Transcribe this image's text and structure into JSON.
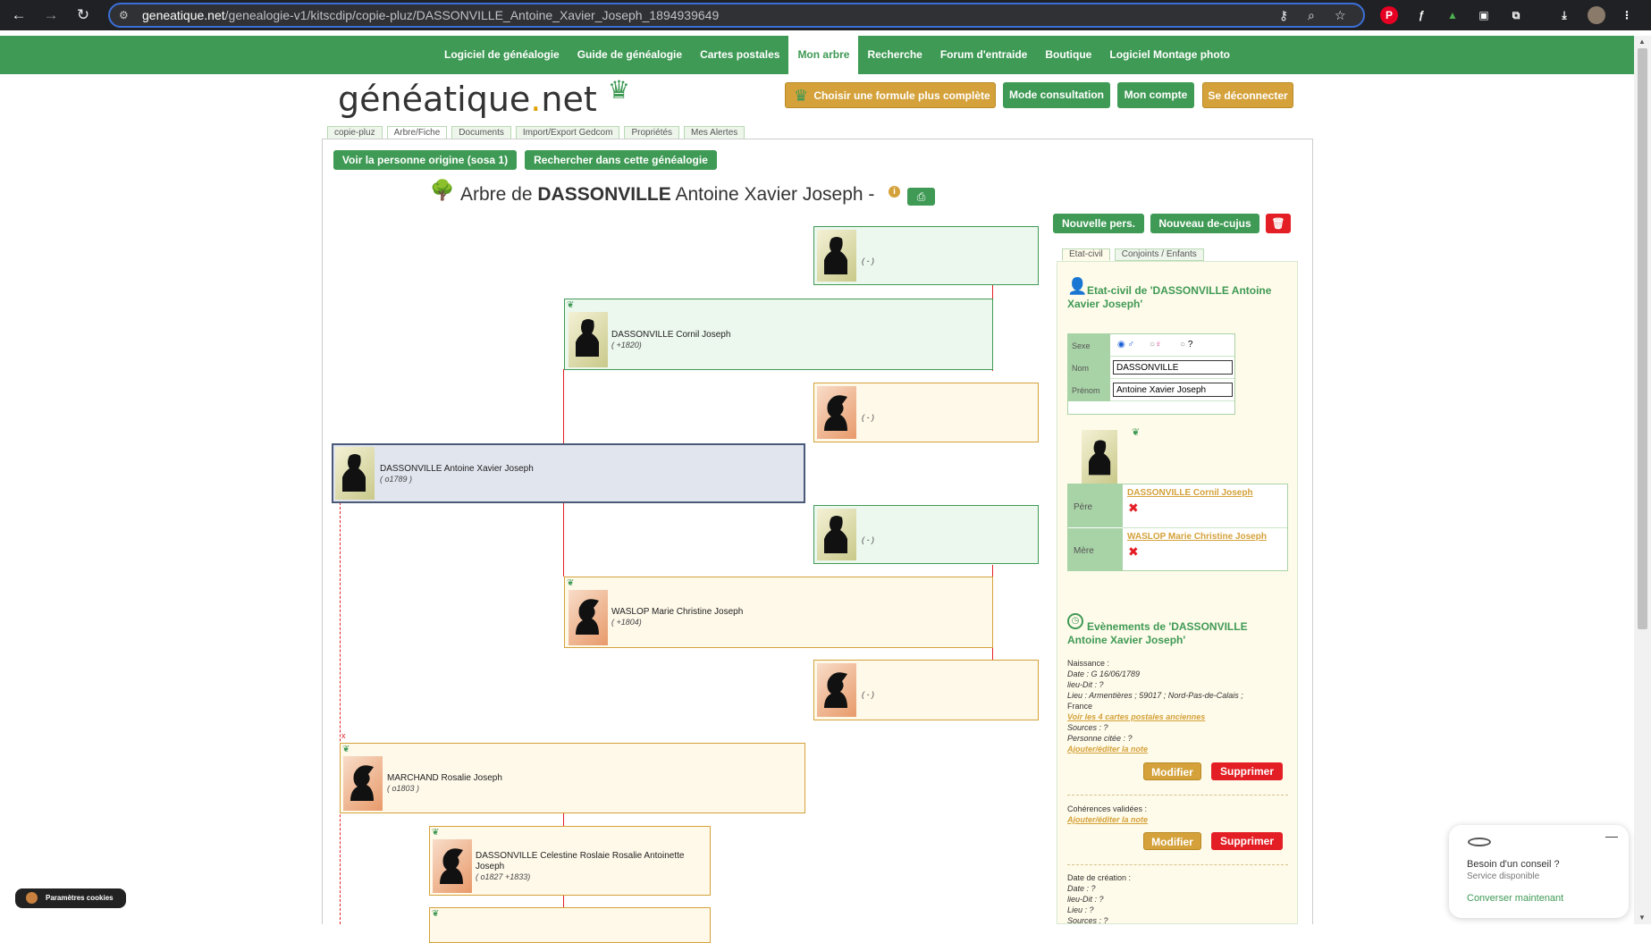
{
  "browser": {
    "url_host": "geneatique.net",
    "url_path": "/genealogie-v1/kitscdip/copie-pluz/DASSONVILLE_Antoine_Xavier_Joseph_1894939649"
  },
  "nav": {
    "items": [
      {
        "label": "Logiciel de généalogie",
        "active": false
      },
      {
        "label": "Guide de généalogie",
        "active": false
      },
      {
        "label": "Cartes postales",
        "active": false
      },
      {
        "label": "Mon arbre",
        "active": true
      },
      {
        "label": "Recherche",
        "active": false
      },
      {
        "label": "Forum d'entraide",
        "active": false
      },
      {
        "label": "Boutique",
        "active": false
      },
      {
        "label": "Logiciel Montage photo",
        "active": false
      }
    ]
  },
  "logo": {
    "part1": "généatique",
    "dot": ".",
    "part2": "net"
  },
  "header_buttons": {
    "formula": "Choisir une formule plus complète",
    "consultation": "Mode consultation",
    "account": "Mon compte",
    "logout": "Se déconnecter"
  },
  "subtabs": [
    "copie-pluz",
    "Arbre/Fiche",
    "Documents",
    "Import/Export Gedcom",
    "Propriétés",
    "Mes Alertes"
  ],
  "actions": {
    "origin": "Voir la personne origine (sosa 1)",
    "search": "Rechercher dans cette généalogie",
    "new_person": "Nouvelle pers.",
    "new_decujus": "Nouveau de-cujus"
  },
  "title": {
    "prefix": "Arbre de",
    "surname": "DASSONVILLE",
    "given": "Antoine Xavier Joseph -"
  },
  "tree": {
    "gp1": {
      "name": "",
      "dates": "( - )"
    },
    "father": {
      "name": "DASSONVILLE  Cornil Joseph",
      "dates": "( +1820)"
    },
    "gp2": {
      "name": "",
      "dates": "( - )"
    },
    "self": {
      "name": "DASSONVILLE  Antoine Xavier Joseph",
      "dates": "( o1789 )"
    },
    "gp3": {
      "name": "",
      "dates": "( - )"
    },
    "mother": {
      "name": "WASLOP  Marie Christine Joseph",
      "dates": "( +1804)"
    },
    "gp4": {
      "name": "",
      "dates": "( - )"
    },
    "spouse": {
      "name": "MARCHAND  Rosalie Joseph",
      "dates": "( o1803 )"
    },
    "child1": {
      "name": "DASSONVILLE  Celestine Roslaie Rosalie Antoinette",
      "name2": "Joseph",
      "dates": "( o1827 +1833)"
    }
  },
  "right_panel": {
    "tabs": [
      "Etat-civil",
      "Conjoints / Enfants"
    ],
    "ec_title": "Etat-civil de 'DASSONVILLE Antoine Xavier Joseph'",
    "sexe_label": "Sexe",
    "nom_label": "Nom",
    "prenom_label": "Prénom",
    "nom_value": "DASSONVILLE",
    "prenom_value": "Antoine Xavier Joseph",
    "sexe_options": [
      "♂",
      "♀",
      "?"
    ],
    "pere_label": "Père",
    "mere_label": "Mère",
    "pere_link": "DASSONVILLE Cornil Joseph",
    "mere_link": "WASLOP Marie Christine Joseph",
    "evt_title": "Evènements de 'DASSONVILLE Antoine Xavier Joseph'",
    "naissance": {
      "heading": "Naissance :",
      "date": "Date : G 16/06/1789",
      "lieudit": "lieu-Dit : ?",
      "lieu": "Lieu : Armentières ; 59017 ; Nord-Pas-de-Calais ;",
      "lieu2": "France",
      "cards_link": "Voir les 4 cartes postales anciennes",
      "sources": "Sources : ?",
      "personne": "Personne citée : ?",
      "note_link": "Ajouter/éditer la note"
    },
    "modify": "Modifier",
    "delete": "Supprimer",
    "coherences": {
      "heading": "Cohérences validées :",
      "note_link": "Ajouter/éditer la note"
    },
    "creation": {
      "heading": "Date de création :",
      "date": "Date : ?",
      "lieudit": "lieu-Dit : ?",
      "lieu": "Lieu : ?",
      "sources": "Sources : ?"
    }
  },
  "chat": {
    "line1": "Besoin d'un conseil ?",
    "line2": "Service disponible",
    "cta": "Converser maintenant"
  },
  "cookie": {
    "label": "Paramètres cookies"
  }
}
